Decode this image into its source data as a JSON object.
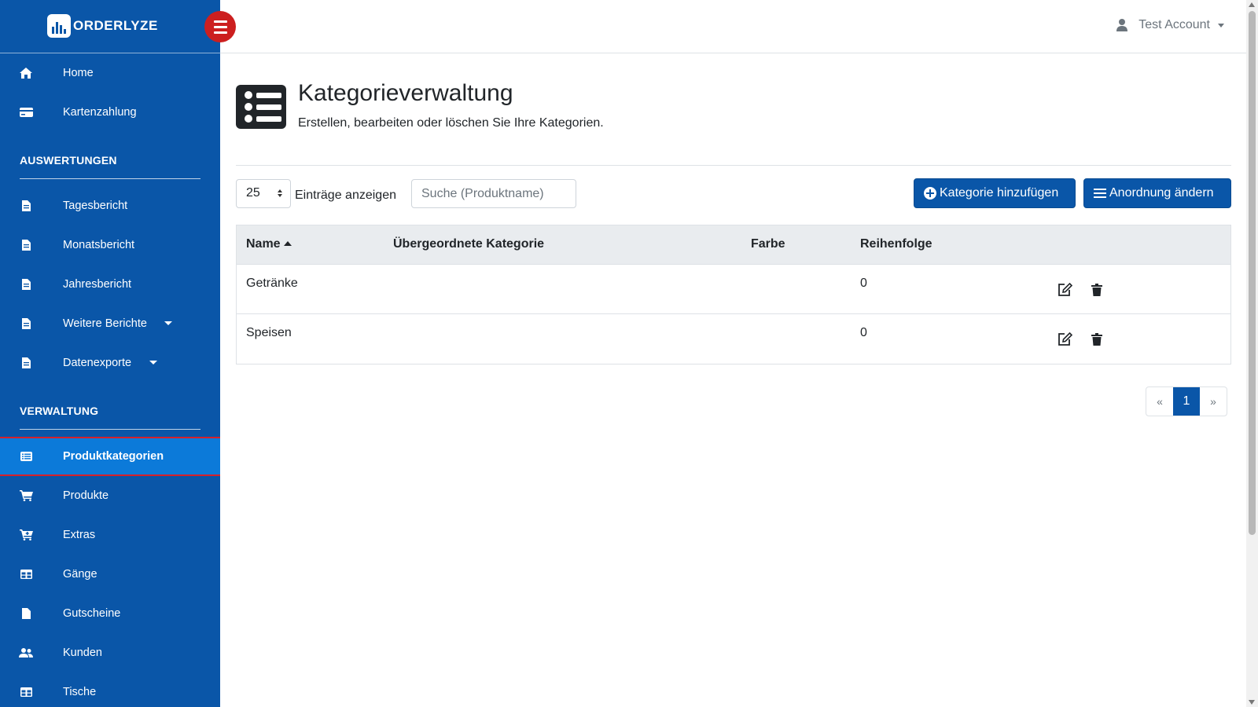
{
  "brand": {
    "name": "ORDERLYZE"
  },
  "header": {
    "account_label": "Test Account"
  },
  "sidebar": {
    "items_top": [
      {
        "label": "Home",
        "icon": "home-icon"
      },
      {
        "label": "Kartenzahlung",
        "icon": "credit-card-icon"
      }
    ],
    "section_reports": "AUSWERTUNGEN",
    "items_reports": [
      {
        "label": "Tagesbericht",
        "icon": "document-icon"
      },
      {
        "label": "Monatsbericht",
        "icon": "document-icon"
      },
      {
        "label": "Jahresbericht",
        "icon": "document-icon"
      },
      {
        "label": "Weitere Berichte",
        "icon": "document-icon"
      },
      {
        "label": "Datenexporte",
        "icon": "document-icon"
      }
    ],
    "section_admin": "VERWALTUNG",
    "items_admin": [
      {
        "label": "Produktkategorien",
        "icon": "list-icon",
        "active": true
      },
      {
        "label": "Produkte",
        "icon": "cart-icon"
      },
      {
        "label": "Extras",
        "icon": "cart-plus-icon"
      },
      {
        "label": "Gänge",
        "icon": "table-icon"
      },
      {
        "label": "Gutscheine",
        "icon": "file-icon"
      },
      {
        "label": "Kunden",
        "icon": "users-icon"
      },
      {
        "label": "Tische",
        "icon": "table-icon"
      }
    ]
  },
  "page": {
    "title": "Kategorieverwaltung",
    "subtitle": "Erstellen, bearbeiten oder löschen Sie Ihre Kategorien."
  },
  "controls": {
    "page_size": "25",
    "entries_label": "Einträge anzeigen",
    "search_placeholder": "Suche (Produktname)",
    "add_label": "Kategorie hinzufügen",
    "order_label": "Anordnung ändern"
  },
  "table": {
    "columns": [
      "Name",
      "Übergeordnete Kategorie",
      "Farbe",
      "Reihenfolge"
    ],
    "rows": [
      {
        "name": "Getränke",
        "parent": "",
        "color": "",
        "order": "0"
      },
      {
        "name": "Speisen",
        "parent": "",
        "color": "",
        "order": "0"
      }
    ]
  },
  "pagination": {
    "prev": "«",
    "current": "1",
    "next": "»"
  },
  "colors": {
    "sidebar": "#0a56a8",
    "active_item": "#0c7ad9",
    "accent_red": "#cc1f1f",
    "primary_button": "#0a56a8"
  }
}
